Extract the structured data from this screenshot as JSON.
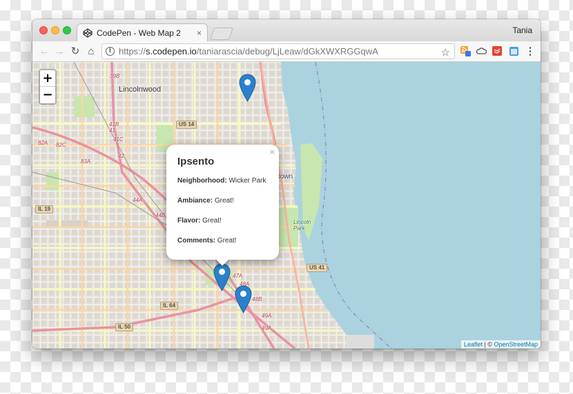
{
  "tab": {
    "title": "CodePen - Web Map 2",
    "close": "×"
  },
  "window": {
    "user": "Tania"
  },
  "toolbar": {
    "back": "←",
    "forward": "→",
    "reload": "↻",
    "home": "⌂",
    "url_scheme": "https://",
    "url_host": "s.codepen.io",
    "url_path": "/taniarascia/debug/LjLeaw/dGkXWXRGGqwA",
    "star": "☆"
  },
  "map": {
    "zoom_in": "+",
    "zoom_out": "−",
    "labels": {
      "lincolnwood": "Lincolnwood",
      "town": "town",
      "lincoln_park": "Lincoln\nPark",
      "us14": "US 14",
      "us41": "US 41",
      "il19": "IL 19",
      "il64": "IL 64",
      "il50": "IL 50",
      "e39b": "39B",
      "e41b": "41B",
      "e41c": "41C",
      "e42": "42",
      "e42a": "82A",
      "e82c": "82C",
      "e83a": "83A",
      "e44a": "44A",
      "e44b": "44B",
      "e47a": "47A",
      "e48a": "48A",
      "e48b": "48B",
      "e49a": "49A",
      "e49b": "49A",
      "e43": "43",
      "e41": "41"
    },
    "attribution": {
      "leaflet": "Leaflet",
      "sep": " | © ",
      "osm": "OpenStreetMap"
    }
  },
  "popup": {
    "title": "Ipsento",
    "close": "×",
    "rows": [
      {
        "label": "Neighborhood:",
        "value": "Wicker Park"
      },
      {
        "label": "Ambiance:",
        "value": "Great!"
      },
      {
        "label": "Flavor:",
        "value": "Great!"
      },
      {
        "label": "Comments:",
        "value": "Great!"
      }
    ]
  },
  "colors": {
    "water": "#aad3df",
    "marker": "#2a81cb",
    "link": "#0078a8"
  }
}
